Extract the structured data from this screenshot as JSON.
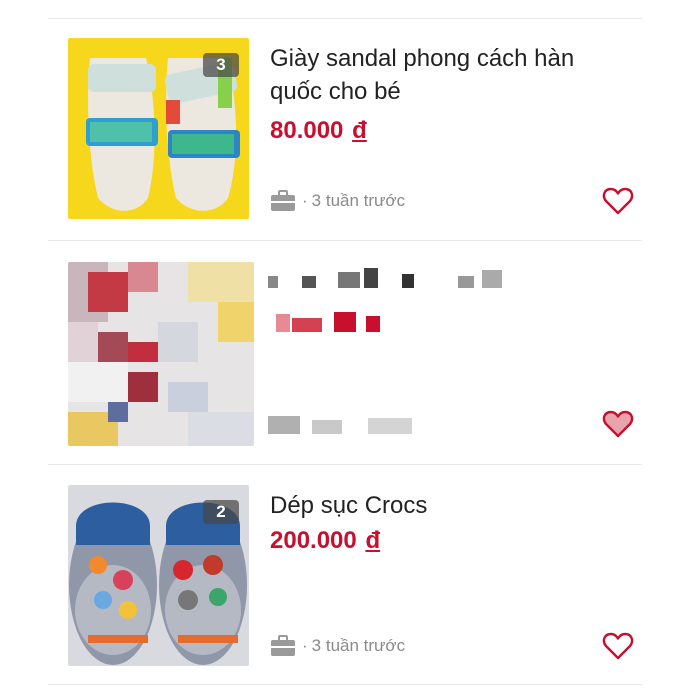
{
  "listings": [
    {
      "title": "Giày sandal phong cách hàn quốc cho bé",
      "price": "80.000",
      "currency": "đ",
      "image_count": "3",
      "posted": "3 tuần trước",
      "category_icon": "briefcase-icon",
      "favorite_icon": "heart-outline-icon"
    },
    {
      "title": "",
      "price": "",
      "note": "blurred listing",
      "favorite_icon": "heart-filled-icon"
    },
    {
      "title": "Dép sục Crocs",
      "price": "200.000",
      "currency": "đ",
      "image_count": "2",
      "posted": "3 tuần trước",
      "category_icon": "briefcase-icon",
      "favorite_icon": "heart-outline-icon"
    }
  ],
  "colors": {
    "price": "#c8102e",
    "heart": "#c8102e",
    "meta_text": "#8a8a8a"
  }
}
